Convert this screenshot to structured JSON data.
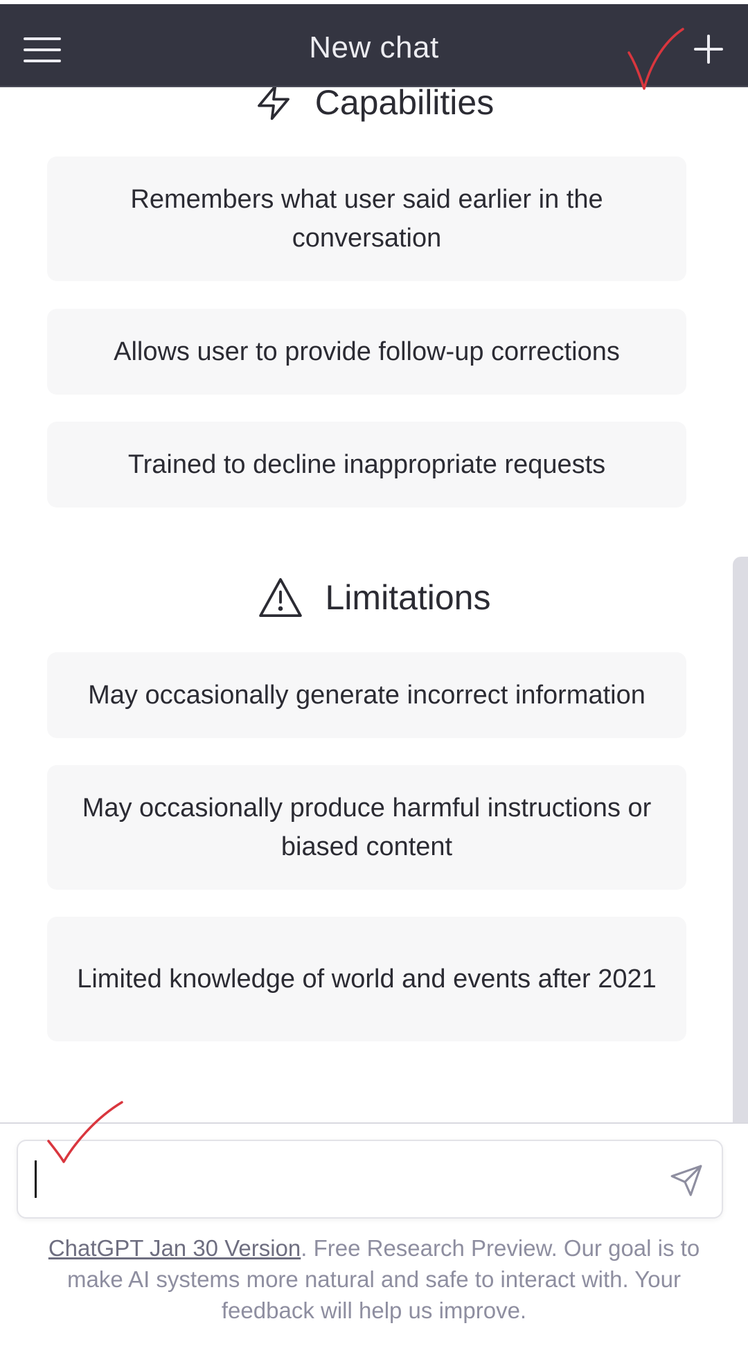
{
  "header": {
    "title": "New chat",
    "menu_icon": "hamburger-menu-icon",
    "new_chat_icon": "plus-icon",
    "background": "#343541"
  },
  "capabilities": {
    "icon": "lightning-bolt-icon",
    "heading": "Capabilities",
    "items": [
      "Remembers what user said earlier in the conversation",
      "Allows user to provide follow-up corrections",
      "Trained to decline inappropriate requests"
    ]
  },
  "limitations": {
    "icon": "warning-triangle-icon",
    "heading": "Limitations",
    "items": [
      "May occasionally generate incorrect information",
      "May occasionally produce harmful instructions or biased content",
      "Limited knowledge of world and events after 2021"
    ]
  },
  "composer": {
    "value": "",
    "send_icon": "send-paper-plane-icon"
  },
  "footer": {
    "link_text": "ChatGPT Jan 30 Version",
    "text": ". Free Research Preview. Our goal is to make AI systems more natural and safe to interact with. Your feedback will help us improve."
  },
  "annotations": {
    "check_color": "#d9363e",
    "icon": "red-checkmark-icon"
  },
  "colors": {
    "card_background": "#f7f7f8",
    "text": "#2b2b33",
    "footer_text": "#8e8ea0"
  }
}
